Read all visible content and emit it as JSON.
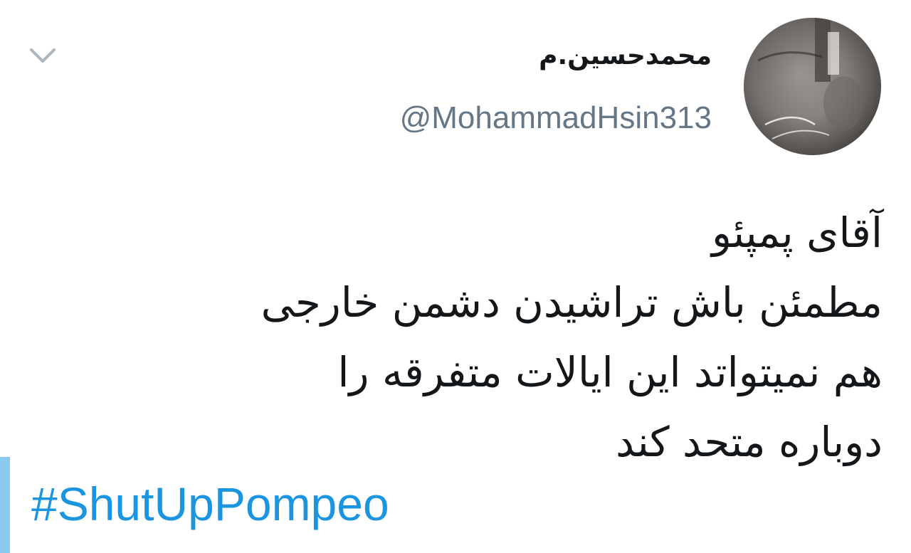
{
  "tweet": {
    "display_name": "محمدحسین.م",
    "handle": "@MohammadHsin313",
    "avatar_icon": "profile-photo",
    "menu_icon": "chevron-down-icon",
    "text_lines": [
      "آقای پمپئو",
      "مطمئن باش تراشیدن دشمن خارجی",
      "هم نمیتواتد این ایالات متفرقه را",
      "دوباره متحد کند"
    ],
    "hashtag": "#ShutUpPompeo"
  },
  "colors": {
    "text": "#14171a",
    "handle": "#657786",
    "link": "#1b95e0",
    "accent_bar": "#8dc9ef",
    "chevron": "#aab8c2"
  }
}
